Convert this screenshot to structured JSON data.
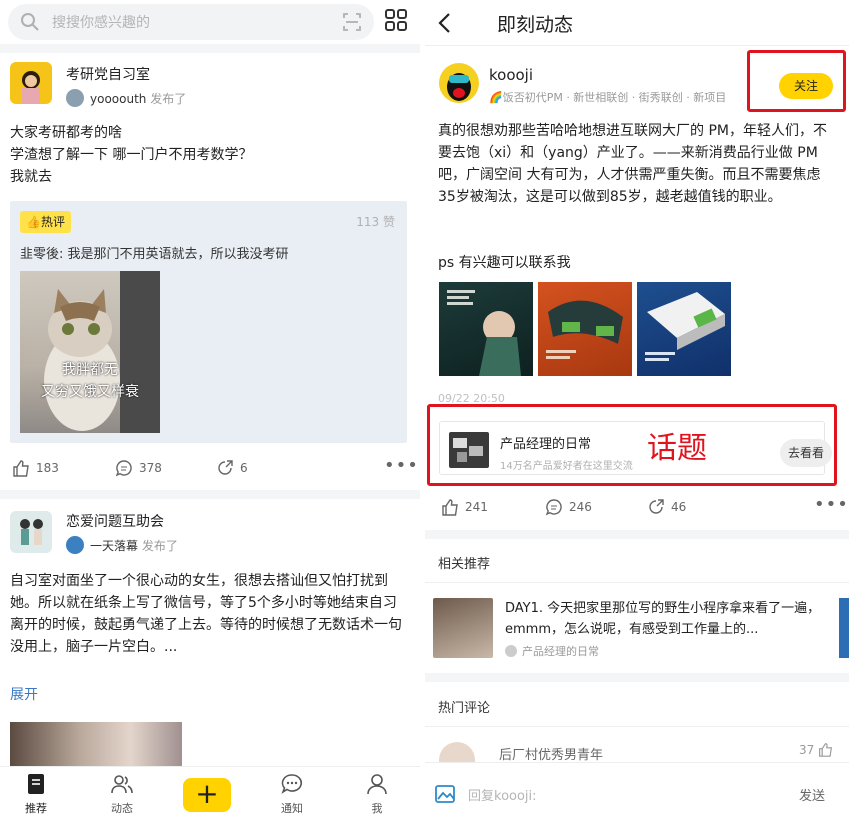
{
  "colors": {
    "accent": "#ffd200",
    "annotation": "#e0141e",
    "link": "#3a78c3"
  },
  "left": {
    "search": {
      "placeholder": "搜搜你感兴趣的"
    },
    "post1": {
      "title": "考研党自习室",
      "author": "yoooouth",
      "action": "发布了",
      "lines": [
        "大家考研都考的啥",
        "学渣想了解一下 哪一门户不用考数学？",
        "我就去"
      ],
      "hot_badge": "热评",
      "hot_count": "113 赞",
      "hot_user": "韭零後:",
      "hot_text": "我是那门不用英语就去，所以我没考研",
      "meme_line1": "我胖都无",
      "meme_line2": "又穷又饿又样衰",
      "likes": "183",
      "comments": "378",
      "shares": "6"
    },
    "post2": {
      "title": "恋爱问题互助会",
      "author": "一天落幕",
      "action": "发布了",
      "text": "自习室对面坐了一个很心动的女生，很想去搭讪但又怕打扰到她。所以就在纸条上写了微信号，等了5个多小时等她结束自习离开的时候，鼓起勇气递了上去。等待的时候想了无数话术一句没用上，脑子一片空白。...",
      "expand": "展开"
    },
    "nav": [
      {
        "label": "推荐",
        "icon": "doc-icon"
      },
      {
        "label": "动态",
        "icon": "people-icon"
      },
      {
        "label": "+",
        "icon": "plus-icon"
      },
      {
        "label": "通知",
        "icon": "chat-icon"
      },
      {
        "label": "我",
        "icon": "person-icon"
      }
    ]
  },
  "right": {
    "title": "即刻动态",
    "author": {
      "name": "koooji",
      "tags": "🌈饭否初代PM · 新世相联创 · 街秀联创 · 新项目",
      "follow": "关注"
    },
    "content": "真的很想劝那些苦哈哈地想进互联网大厂的 PM，年轻人们，不要去饱（xi）和（yang）产业了。——来新消费品行业做 PM 吧，广阔空间 大有可为，人才供需严重失衡。而且不需要焦虑35岁被淘汰，这是可以做到85岁，越老越值钱的职业。",
    "ps": "ps 有兴趣可以联系我",
    "time": "09/22 20:50",
    "topic": {
      "name": "产品经理的日常",
      "desc": "14万名产品爱好者在这里交流",
      "go": "去看看",
      "annotation": "话题"
    },
    "likes": "241",
    "comments": "246",
    "shares": "46",
    "related_title": "相关推荐",
    "related": {
      "text": "DAY1. 今天把家里那位写的野生小程序拿来看了一遍，emmm，怎么说呢，有感受到工作量上的...",
      "topic": "产品经理的日常"
    },
    "hot_comments_title": "热门评论",
    "comment": {
      "user": "后厂村优秀男青年",
      "likes": "37"
    },
    "reply": {
      "placeholder": "回复koooji:",
      "send": "发送"
    }
  }
}
